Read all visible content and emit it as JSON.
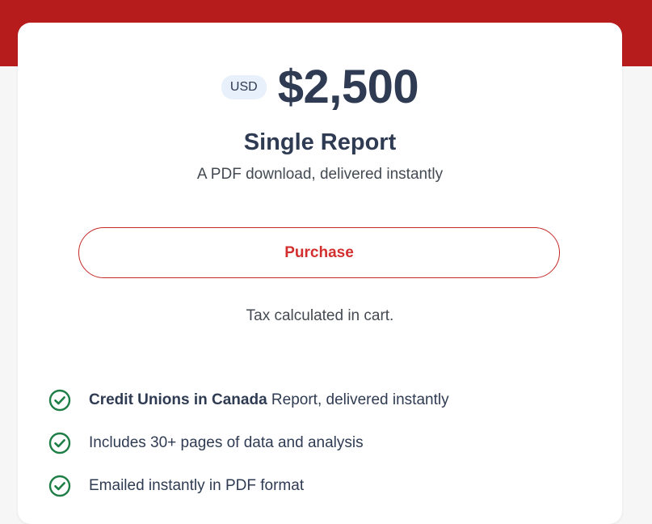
{
  "colors": {
    "brand_red": "#b71c1c",
    "button_red": "#d32f2f",
    "text_dark": "#2f3b52",
    "check_green": "#1e7e46",
    "badge_bg": "#e8f0fb"
  },
  "pricing": {
    "currency": "USD",
    "price": "$2,500",
    "title": "Single Report",
    "subtitle": "A PDF download, delivered instantly",
    "purchase_label": "Purchase",
    "tax_note": "Tax calculated in cart."
  },
  "features": [
    {
      "bold": "Credit Unions in Canada",
      "text": " Report, delivered instantly",
      "icon": "check-circle-icon"
    },
    {
      "bold": "",
      "text": "Includes 30+ pages of data and analysis",
      "icon": "check-circle-icon"
    },
    {
      "bold": "",
      "text": "Emailed instantly in PDF format",
      "icon": "check-circle-icon"
    }
  ]
}
